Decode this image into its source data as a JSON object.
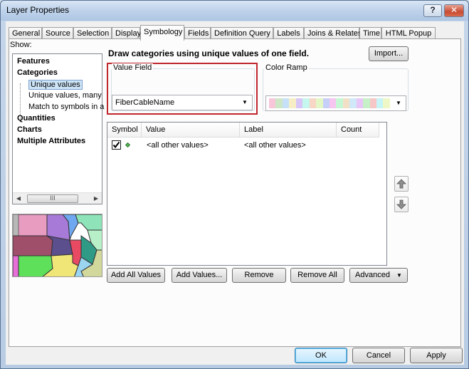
{
  "window": {
    "title": "Layer Properties",
    "help_label": "?",
    "close_label": "✕"
  },
  "tabs": [
    {
      "label": "General"
    },
    {
      "label": "Source"
    },
    {
      "label": "Selection"
    },
    {
      "label": "Display"
    },
    {
      "label": "Symbology"
    },
    {
      "label": "Fields"
    },
    {
      "label": "Definition Query"
    },
    {
      "label": "Labels"
    },
    {
      "label": "Joins & Relates"
    },
    {
      "label": "Time"
    },
    {
      "label": "HTML Popup"
    }
  ],
  "active_tab": "Symbology",
  "show": {
    "label": "Show:",
    "items": [
      {
        "label": "Features",
        "bold": true
      },
      {
        "label": "Categories",
        "bold": true
      },
      {
        "label": "Unique values",
        "bold": false,
        "selected": true
      },
      {
        "label": "Unique values, many",
        "bold": false
      },
      {
        "label": "Match to symbols in a",
        "bold": false
      },
      {
        "label": "Quantities",
        "bold": true
      },
      {
        "label": "Charts",
        "bold": true
      },
      {
        "label": "Multiple Attributes",
        "bold": true
      }
    ],
    "scroll_grip": "III"
  },
  "heading": "Draw categories using unique values of one field.",
  "import_label": "Import...",
  "value_field": {
    "label": "Value Field",
    "value": "FiberCableName"
  },
  "color_ramp": {
    "label": "Color Ramp",
    "colors": [
      "#f7c6d9",
      "#cde7c6",
      "#c6e1f7",
      "#f7eec6",
      "#d7c6f7",
      "#c6f7ee",
      "#f7d6c6",
      "#e3f7c6",
      "#c6cff7",
      "#f7c6f0",
      "#c6f7d4",
      "#f2e0c6",
      "#d0e8f7",
      "#e8c6f7",
      "#c6f0c8",
      "#f7c6c6",
      "#c6f4f7",
      "#eef7c6"
    ]
  },
  "table": {
    "columns": [
      "Symbol",
      "Value",
      "Label",
      "Count"
    ],
    "rows": [
      {
        "checked": true,
        "value": "<all other values>",
        "label": "<all other values>",
        "count": ""
      }
    ]
  },
  "buttons": {
    "add_all": "Add All Values",
    "add_values": "Add Values...",
    "remove": "Remove",
    "remove_all": "Remove All",
    "advanced": "Advanced",
    "ok": "OK",
    "cancel": "Cancel",
    "apply": "Apply"
  },
  "colors": {
    "highlight_box": "#c0272d",
    "selected_item": "#cde4f7"
  }
}
